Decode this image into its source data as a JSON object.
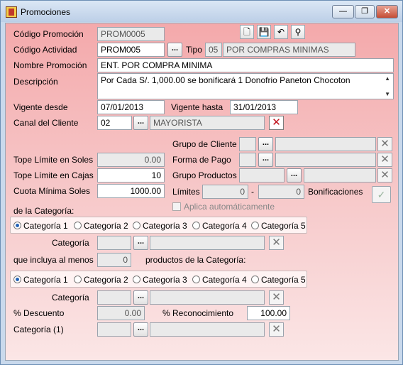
{
  "window": {
    "title": "Promociones",
    "minimize": "—",
    "maximize": "❐",
    "close": "✕"
  },
  "toolbar": {
    "new_icon": "🗋",
    "save_icon": "💾",
    "undo_icon": "↶",
    "search_icon": "⚲"
  },
  "fields": {
    "codigo_promocion": {
      "label": "Código Promoción",
      "value": "PROM0005"
    },
    "codigo_actividad": {
      "label": "Código Actividad",
      "value": "PROM005"
    },
    "tipo": {
      "label": "Tipo",
      "code": "05",
      "value": "POR COMPRAS MINIMAS"
    },
    "nombre_promocion": {
      "label": "Nombre Promoción",
      "value": "ENT. POR COMPRA MINIMA"
    },
    "descripcion": {
      "label": "Descripción",
      "value": "Por Cada S/. 1,000.00 se bonificará 1 Donofrio Paneton Chocoton"
    },
    "vigente_desde": {
      "label": "Vigente desde",
      "value": "07/01/2013"
    },
    "vigente_hasta": {
      "label": "Vigente hasta",
      "value": "31/01/2013"
    },
    "canal_cliente": {
      "label": "Canal del Cliente",
      "code": "02",
      "value": "MAYORISTA"
    },
    "grupo_cliente": {
      "label": "Grupo de Cliente"
    },
    "forma_pago": {
      "label": "Forma de Pago"
    },
    "grupo_productos": {
      "label": "Grupo Productos"
    },
    "limites": {
      "label": "Límites",
      "from": "0",
      "sep": "-",
      "to": "0"
    },
    "bonificaciones": {
      "label": "Bonificaciones"
    },
    "aplica": {
      "label": "Aplica automáticamente"
    },
    "tope_soles": {
      "label": "Tope Límite en Soles",
      "value": "0.00"
    },
    "tope_cajas": {
      "label": "Tope Límite en Cajas",
      "value": "10"
    },
    "cuota_minima": {
      "label": "Cuota Mínima Soles",
      "value": "1000.00"
    },
    "de_la_categoria": {
      "label": "de la Categoría:"
    },
    "categoria_1": {
      "label": "Categoría"
    },
    "que_incluya": {
      "label": "que incluya al menos",
      "value": "0",
      "suffix": "productos de la Categoría:"
    },
    "categoria_2": {
      "label": "Categoría"
    },
    "descuento": {
      "label": "% Descuento",
      "value": "0.00"
    },
    "reconocimiento": {
      "label": "% Reconocimiento",
      "value": "100.00"
    },
    "categoria_3": {
      "label": "Categoría (1)"
    }
  },
  "radios_a": [
    "Categoría 1",
    "Categoría 2",
    "Categoría 3",
    "Categoría 4",
    "Categoría 5"
  ],
  "radios_b": [
    "Categoría 1",
    "Categoría 2",
    "Categoría 3",
    "Categoría 4",
    "Categoría 5"
  ],
  "dots_label": "...",
  "x_label": "✕",
  "check_label": "✓"
}
